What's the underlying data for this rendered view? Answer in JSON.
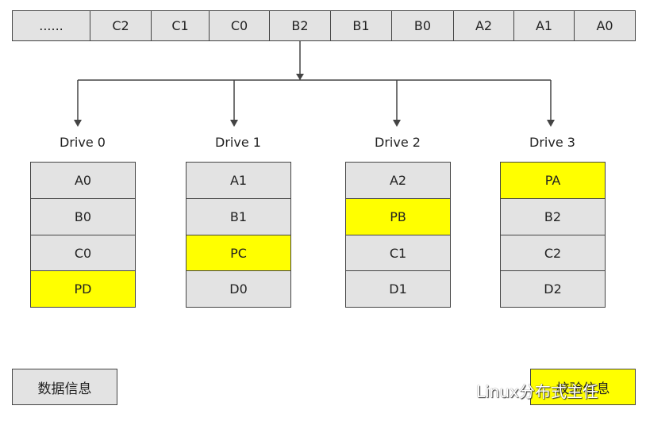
{
  "stripe": [
    "......",
    "C2",
    "C1",
    "C0",
    "B2",
    "B1",
    "B0",
    "A2",
    "A1",
    "A0"
  ],
  "drives": [
    {
      "label": "Drive 0",
      "blocks": [
        {
          "t": "A0",
          "parity": false
        },
        {
          "t": "B0",
          "parity": false
        },
        {
          "t": "C0",
          "parity": false
        },
        {
          "t": "PD",
          "parity": true
        }
      ]
    },
    {
      "label": "Drive 1",
      "blocks": [
        {
          "t": "A1",
          "parity": false
        },
        {
          "t": "B1",
          "parity": false
        },
        {
          "t": "PC",
          "parity": true
        },
        {
          "t": "D0",
          "parity": false
        }
      ]
    },
    {
      "label": "Drive 2",
      "blocks": [
        {
          "t": "A2",
          "parity": false
        },
        {
          "t": "PB",
          "parity": true
        },
        {
          "t": "C1",
          "parity": false
        },
        {
          "t": "D1",
          "parity": false
        }
      ]
    },
    {
      "label": "Drive 3",
      "blocks": [
        {
          "t": "PA",
          "parity": true
        },
        {
          "t": "B2",
          "parity": false
        },
        {
          "t": "C2",
          "parity": false
        },
        {
          "t": "D2",
          "parity": false
        }
      ]
    }
  ],
  "legend": {
    "data": "数据信息",
    "parity": "校验信息"
  },
  "watermark": "Linux分布式主任",
  "colors": {
    "data": "#e3e3e3",
    "parity": "#ffff00"
  }
}
